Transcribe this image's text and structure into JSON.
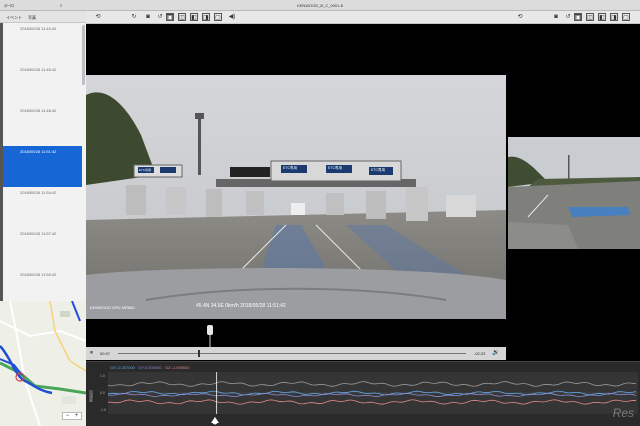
{
  "window": {
    "menu_left": "ｽﾃｰﾀｽ",
    "menu_second": "≡",
    "title": "KENWOOD_B_C_0001-8"
  },
  "tabs": {
    "events": "イベント",
    "photos": "写真"
  },
  "files": [
    {
      "timestamp": "2018/05/28 11:43:42",
      "selected": false
    },
    {
      "timestamp": "2018/05/28 11:45:42",
      "selected": false
    },
    {
      "timestamp": "2018/05/28 11:48:42",
      "selected": false
    },
    {
      "timestamp": "2018/05/28 11:51:42",
      "selected": true
    },
    {
      "timestamp": "2018/05/28 11:54:42",
      "selected": false
    },
    {
      "timestamp": "2018/05/28 11:57:42",
      "selected": false
    },
    {
      "timestamp": "2018/05/28 11:59:42",
      "selected": false
    }
  ],
  "map": {
    "zoom_out": "−",
    "zoom_in": "+"
  },
  "toolbar_icons": [
    "rewind-icon",
    "camera-icon",
    "rotate-icon",
    "layout-icon",
    "view-1-icon",
    "view-2-icon",
    "view-3-icon",
    "view-4-icon",
    "volume-icon"
  ],
  "player": {
    "current_time": "00:37",
    "remaining_time": "-02:23",
    "progress": 0.23,
    "play_icon": "⏸",
    "volume_icon": "🔊"
  },
  "video_overlay": {
    "brand_stamp": "KENWOOD  DRV-MR880",
    "stamp_text": "45.4N 34.5E  0km/h  2018/05/28  11:51:42",
    "sign_1": "ETC専用",
    "sign_2": "ETC専用",
    "sign_3": "ETC専用",
    "sign_4": "ETC専用"
  },
  "graph": {
    "legend_x": "GX:-0.257000",
    "legend_y": "GY:0.000000",
    "legend_z": "GZ:-1.090000",
    "axis_label": "加速度",
    "ticks": [
      "1.0",
      "0.0",
      "-1.0"
    ],
    "cursor_fraction": 0.205,
    "colors": {
      "x": "#5fa8e8",
      "y": "#8c8cd8",
      "z": "#e08a8a"
    }
  },
  "watermark": "Res"
}
